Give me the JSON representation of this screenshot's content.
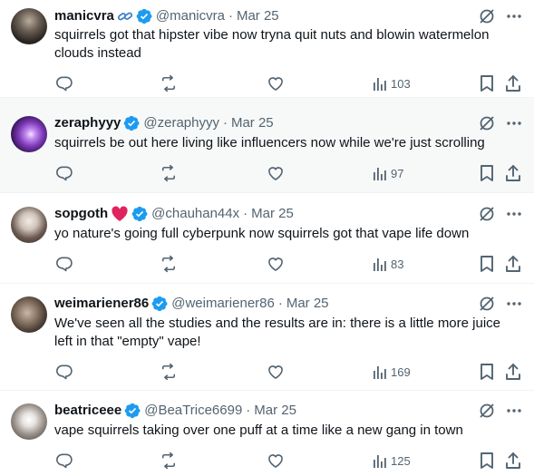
{
  "colors": {
    "verified": "#1d9bf0",
    "heart_emoji": "#e0245e",
    "chain_link": "#3b82c4",
    "muted": "#536471"
  },
  "tweets": [
    {
      "name": "manicvra",
      "handle": "@manicvra",
      "date": "Mar 25",
      "separator": "·",
      "decoration": "chain-link-icon",
      "text": "squirrels got that hipster vibe now tryna quit nuts and blowin watermelon clouds instead",
      "views": "103",
      "highlighted": false
    },
    {
      "name": "zeraphyyy",
      "handle": "@zeraphyyy",
      "date": "Mar 25",
      "separator": "·",
      "decoration": "",
      "text": "squirrels be out here living like influencers now while we're just scrolling",
      "views": "97",
      "highlighted": true
    },
    {
      "name": "sopgoth",
      "handle": "@chauhan44x",
      "date": "Mar 25",
      "separator": "·",
      "decoration": "red-heart-icon",
      "text": "yo nature's going full cyberpunk now squirrels got that vape life down",
      "views": "83",
      "highlighted": false
    },
    {
      "name": "weimariener86",
      "handle": "@weimariener86",
      "date": "Mar 25",
      "separator": "·",
      "decoration": "",
      "text": "We've seen all the studies and the results are in: there is a little more juice left in that \"empty\" vape!",
      "views": "169",
      "highlighted": false
    },
    {
      "name": "beatriceee",
      "handle": "@BeaTrice6699",
      "date": "Mar 25",
      "separator": "·",
      "decoration": "",
      "text": "vape squirrels taking over one puff at a time like a new gang in town",
      "views": "125",
      "highlighted": false
    }
  ]
}
